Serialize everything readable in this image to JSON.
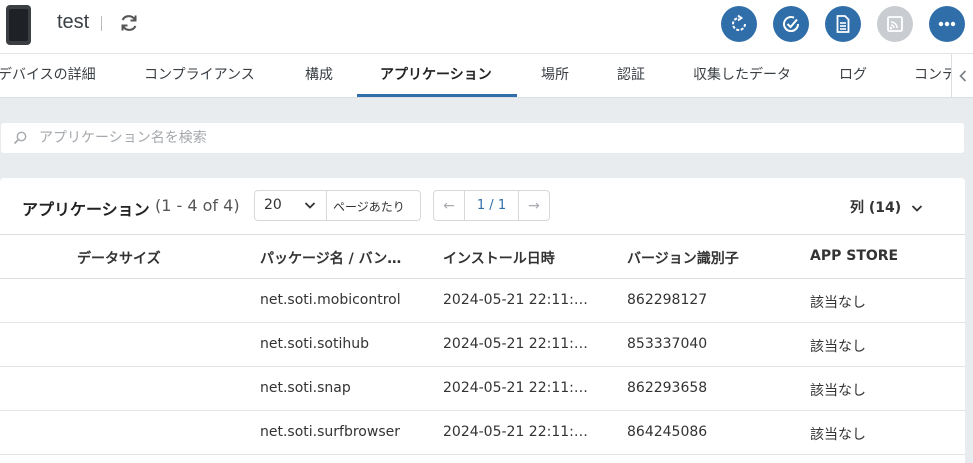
{
  "header": {
    "title": "test",
    "actions": [
      "sync-icon",
      "check-circle-icon",
      "document-icon",
      "cast-icon",
      "more-icon"
    ]
  },
  "tabs": [
    {
      "label": "デバイスの詳細"
    },
    {
      "label": "コンプライアンス"
    },
    {
      "label": "構成"
    },
    {
      "label": "アプリケーション"
    },
    {
      "label": "場所"
    },
    {
      "label": "認証"
    },
    {
      "label": "収集したデータ"
    },
    {
      "label": "ログ"
    },
    {
      "label": "コンテ"
    }
  ],
  "search": {
    "placeholder": "アプリケーション名を検索"
  },
  "panel": {
    "title": "アプリケーション",
    "count": "(1 - 4 of 4)",
    "per_page_value": "20",
    "per_page_label": "ページあたり",
    "page": "1 / 1",
    "prev": "←",
    "next": "→",
    "columns_label": "列 (14)"
  },
  "table": {
    "headers": [
      "データサイズ",
      "パッケージ名 / バン…",
      "インストール日時",
      "バージョン識別子",
      "APP STORE"
    ],
    "rows": [
      {
        "size": "",
        "package": "net.soti.mobicontrol",
        "installed": "2024-05-21 22:11:…",
        "version": "862298127",
        "store": "該当なし"
      },
      {
        "size": "",
        "package": "net.soti.sotihub",
        "installed": "2024-05-21 22:11:…",
        "version": "853337040",
        "store": "該当なし"
      },
      {
        "size": "",
        "package": "net.soti.snap",
        "installed": "2024-05-21 22:11:…",
        "version": "862293658",
        "store": "該当なし"
      },
      {
        "size": "",
        "package": "net.soti.surfbrowser",
        "installed": "2024-05-21 22:11:…",
        "version": "864245086",
        "store": "該当なし"
      }
    ]
  },
  "colors": {
    "accent": "#2f6ea9",
    "disabled": "#c9cdd1",
    "background": "#e9ecef"
  }
}
